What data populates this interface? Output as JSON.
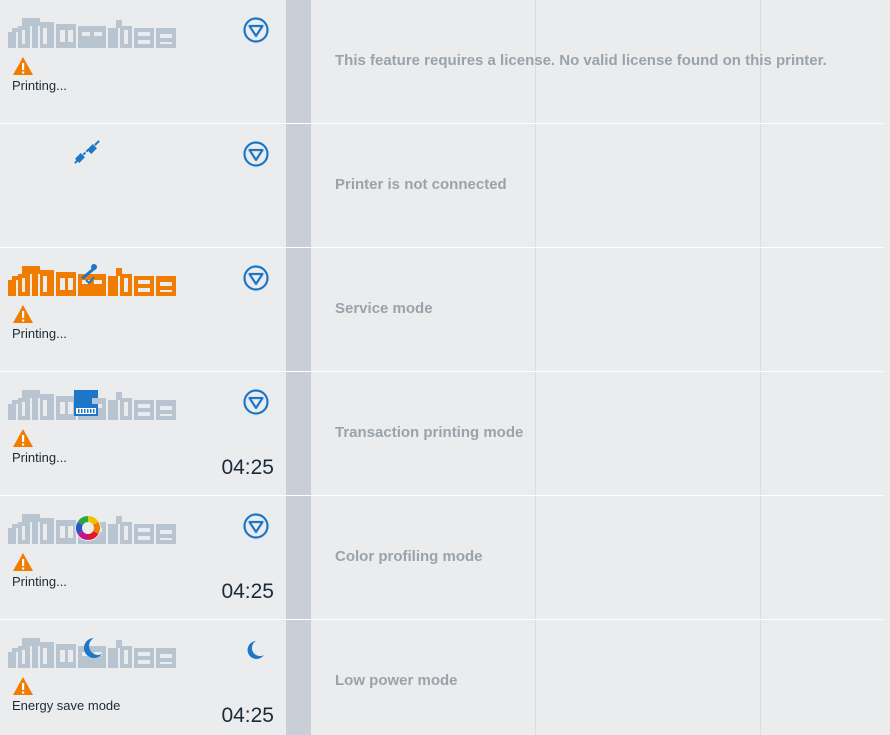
{
  "rows": [
    {
      "printer_icon": "printer-grey-icon",
      "status": "Printing...",
      "action_icon": "stop-icon",
      "timer": "",
      "message": "This feature requires a license. No valid license found on this printer."
    },
    {
      "printer_icon": "disconnected-plug-icon",
      "status": "",
      "action_icon": "stop-icon",
      "timer": "",
      "message": "Printer is not connected"
    },
    {
      "printer_icon": "printer-service-orange-icon",
      "status": "Printing...",
      "action_icon": "stop-icon",
      "timer": "",
      "message": "Service mode"
    },
    {
      "printer_icon": "printer-transaction-icon",
      "status": "Printing...",
      "action_icon": "stop-icon",
      "timer": "04:25",
      "message": "Transaction printing mode"
    },
    {
      "printer_icon": "printer-color-profiling-icon",
      "status": "Printing...",
      "action_icon": "stop-icon",
      "timer": "04:25",
      "message": "Color profiling mode"
    },
    {
      "printer_icon": "printer-low-power-icon",
      "status": "Energy save mode",
      "action_icon": "moon-icon",
      "timer": "04:25",
      "message": "Low power mode"
    }
  ],
  "colors": {
    "accent_blue": "#1d77c9",
    "warning_orange": "#f07d00",
    "printer_grey": "#b8c4d0",
    "service_orange": "#f07d00",
    "message_grey": "#9aa3ab"
  }
}
